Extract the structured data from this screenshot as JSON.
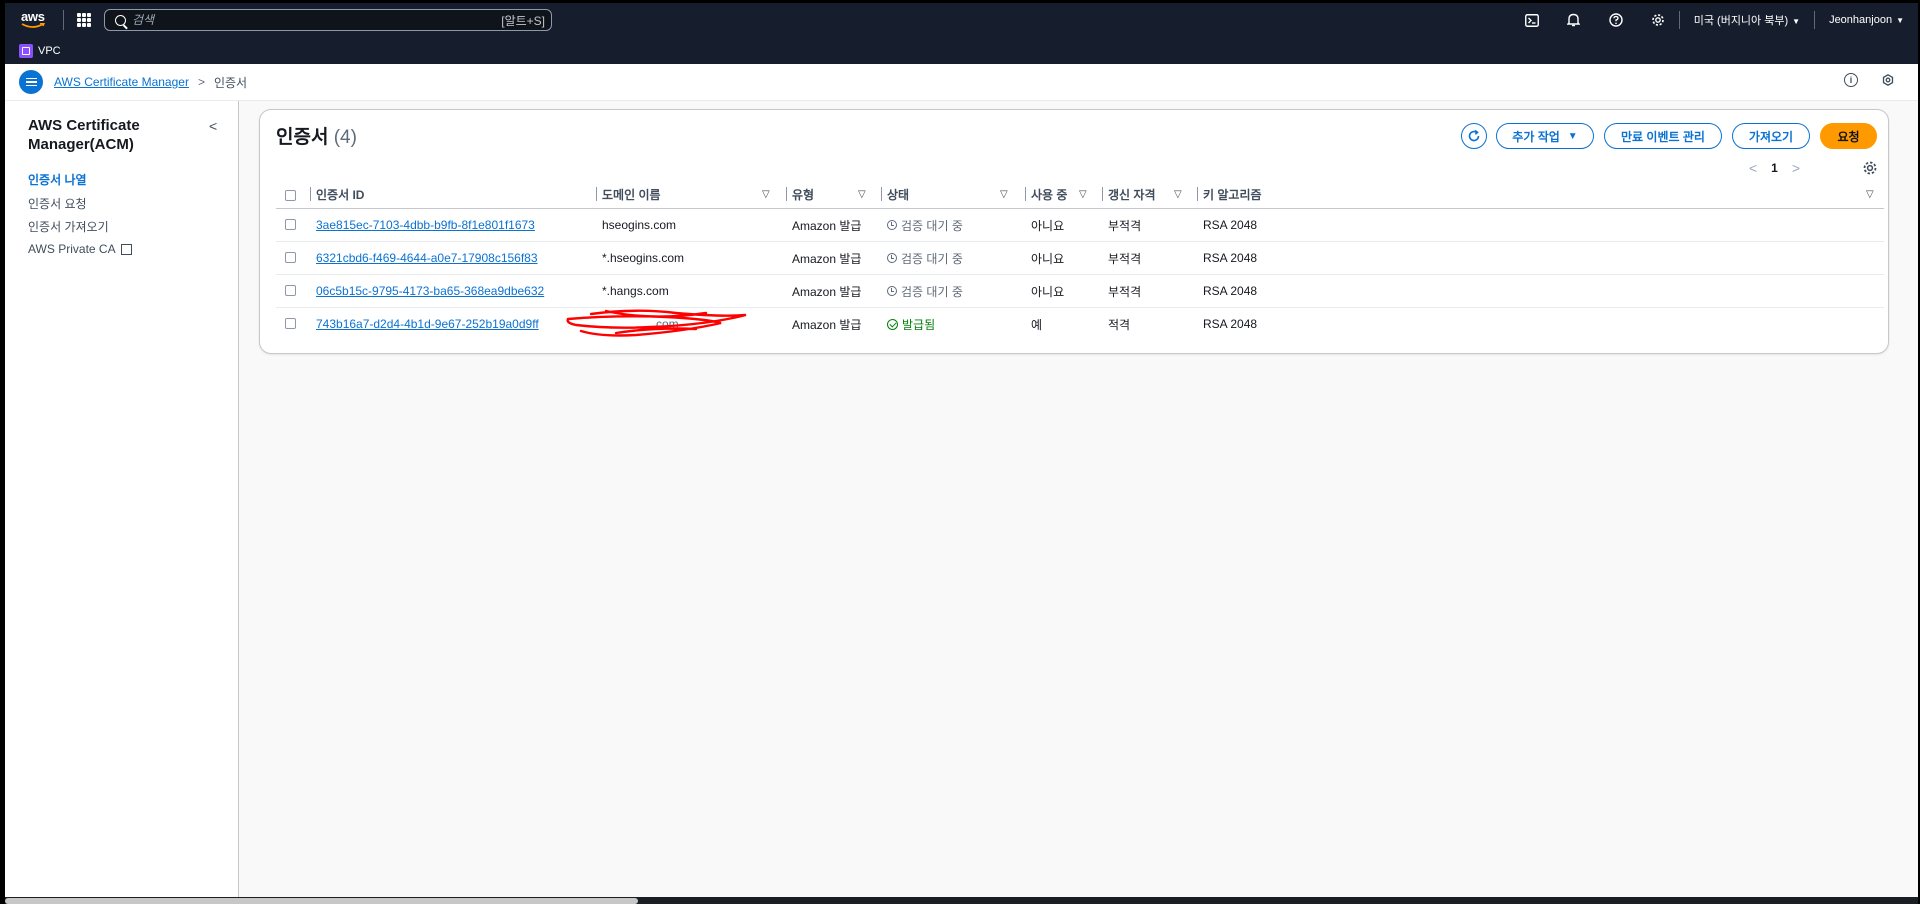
{
  "topnav": {
    "logo_text": "aws",
    "search_placeholder": "검색",
    "search_shortcut": "[알트+S]",
    "region": "미국 (버지니아 북부)",
    "user": "Jeonhanjoon"
  },
  "favorites": {
    "vpc_label": "VPC"
  },
  "breadcrumb": {
    "root": "AWS Certificate Manager",
    "current": "인증서"
  },
  "sidebar": {
    "title": "AWS Certificate Manager(ACM)",
    "items": [
      {
        "label": "인증서 나열",
        "active": true
      },
      {
        "label": "인증서 요청"
      },
      {
        "label": "인증서 가져오기"
      },
      {
        "label": "AWS Private CA",
        "external": true
      }
    ]
  },
  "panel": {
    "title": "인증서",
    "count": "(4)",
    "buttons": {
      "actions": "추가 작업",
      "expiry": "만료 이벤트 관리",
      "import": "가져오기",
      "request": "요청"
    },
    "page": "1"
  },
  "table": {
    "columns": [
      "인증서 ID",
      "도메인 이름",
      "유형",
      "상태",
      "사용 중",
      "갱신 자격",
      "키 알고리즘"
    ],
    "rows": [
      {
        "id": "3ae815ec-7103-4dbb-b9fb-8f1e801f1673",
        "domain": "hseogins.com",
        "type": "Amazon 발급",
        "status": "검증 대기 중",
        "in_use": "아니요",
        "renewal": "부적격",
        "algo": "RSA 2048"
      },
      {
        "id": "6321cbd6-f469-4644-a0e7-17908c156f83",
        "domain": "*.hseogins.com",
        "type": "Amazon 발급",
        "status": "검증 대기 중",
        "in_use": "아니요",
        "renewal": "부적격",
        "algo": "RSA 2048"
      },
      {
        "id": "06c5b15c-9795-4173-ba65-368ea9dbe632",
        "domain": "*.hangs.com",
        "type": "Amazon 발급",
        "status": "검증 대기 중",
        "in_use": "아니요",
        "renewal": "부적격",
        "algo": "RSA 2048"
      },
      {
        "id": "743b16a7-d2d4-4b1d-9e67-252b19a0d9ff",
        "domain": "com",
        "type": "Amazon 발급",
        "status": "발급됨",
        "in_use": "예",
        "renewal": "적격",
        "algo": "RSA 2048"
      }
    ]
  },
  "colors": {
    "nav_bg": "#161e2d",
    "link": "#0972d3",
    "primary_button": "#ff9900",
    "issued_green": "#037f0c",
    "redaction": "#ff0000"
  },
  "icons": [
    "search-icon",
    "apps-grid-icon",
    "cloudshell-icon",
    "bell-icon",
    "help-icon",
    "gear-icon",
    "menu-icon",
    "info-icon",
    "refresh-icon",
    "clock-icon",
    "check-circle-icon",
    "external-link-icon"
  ]
}
